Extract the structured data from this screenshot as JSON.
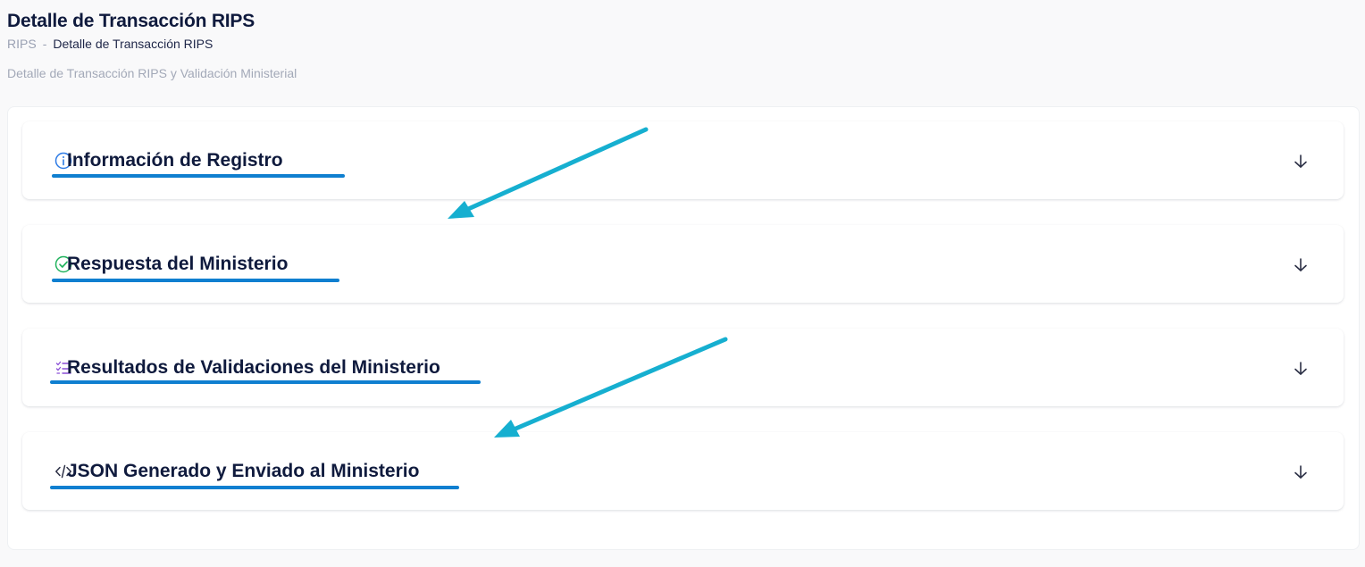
{
  "header": {
    "title": "Detalle de Transacción RIPS",
    "breadcrumb": {
      "root": "RIPS",
      "separator": "-",
      "current": "Detalle de Transacción RIPS"
    },
    "subtitle": "Detalle de Transacción RIPS y Validación Ministerial"
  },
  "sections": [
    {
      "title": "Información de Registro",
      "icon": "info-icon",
      "icon_color": "#2d7be5"
    },
    {
      "title": "Respuesta del Ministerio",
      "icon": "check-circle-icon",
      "icon_color": "#22b35e"
    },
    {
      "title": "Resultados de Validaciones del Ministerio",
      "icon": "checklist-icon",
      "icon_color": "#8a4fd6"
    },
    {
      "title": "JSON Generado y Enviado al Ministerio",
      "icon": "code-icon",
      "icon_color": "#2b2f45"
    }
  ],
  "annotations": {
    "underline_color": "#0f7fd0",
    "arrow_color": "#16afd0"
  }
}
